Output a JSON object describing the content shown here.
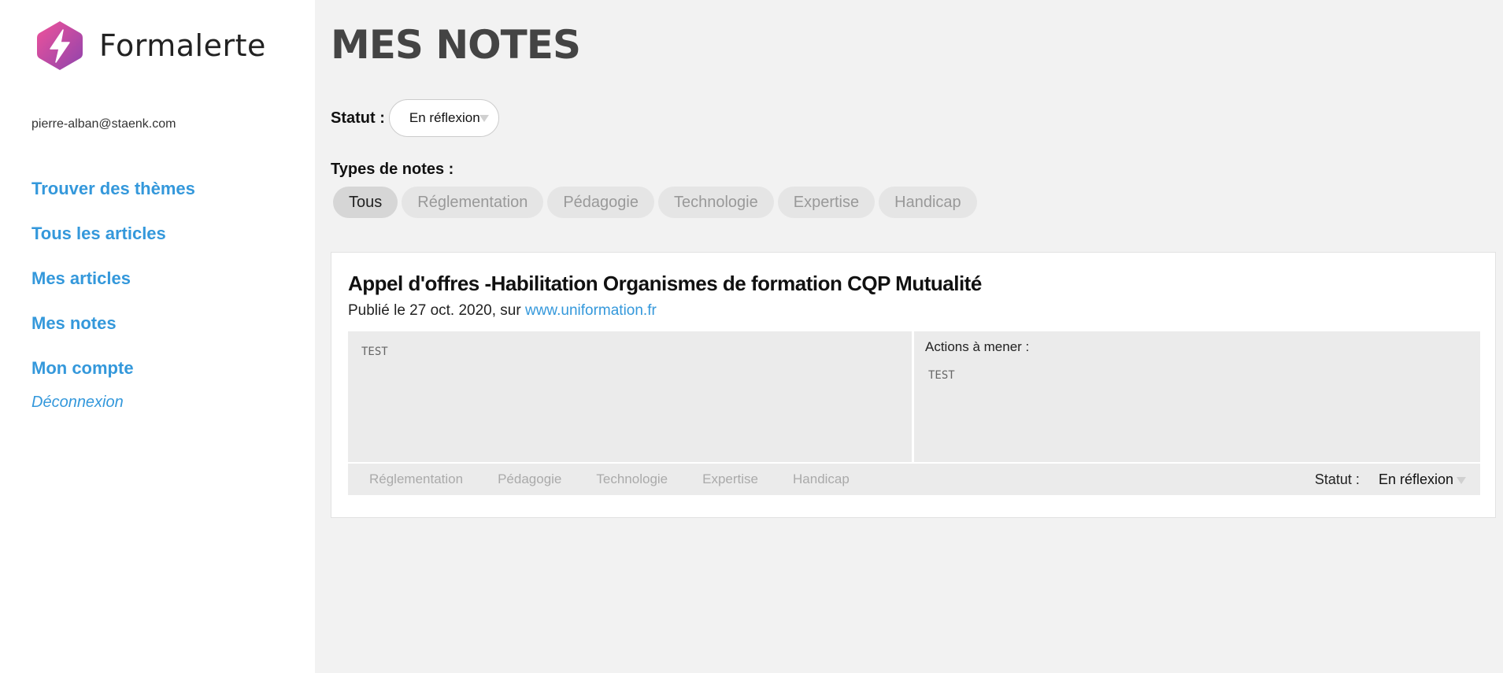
{
  "sidebar": {
    "brand_name": "Formalerte",
    "user_email": "pierre-alban@staenk.com",
    "nav_items": [
      {
        "label": "Trouver des thèmes"
      },
      {
        "label": "Tous les articles"
      },
      {
        "label": "Mes articles"
      },
      {
        "label": "Mes notes"
      },
      {
        "label": "Mon compte"
      }
    ],
    "logout_label": "Déconnexion"
  },
  "main": {
    "title": "MES NOTES",
    "status_label": "Statut :",
    "status_value": "En réflexion",
    "types_label": "Types de notes :",
    "type_filters": [
      {
        "label": "Tous",
        "active": true
      },
      {
        "label": "Réglementation"
      },
      {
        "label": "Pédagogie"
      },
      {
        "label": "Technologie"
      },
      {
        "label": "Expertise"
      },
      {
        "label": "Handicap"
      }
    ]
  },
  "note": {
    "title": "Appel d'offres -Habilitation Organismes de formation CQP Mutualité",
    "published_prefix": "Publié le 27 oct. 2020, sur ",
    "source_link": "www.uniformation.fr",
    "note_text": "TEST",
    "actions_label": "Actions à mener :",
    "actions_text": "TEST",
    "tags": [
      "Réglementation",
      "Pédagogie",
      "Technologie",
      "Expertise",
      "Handicap"
    ],
    "status_label": "Statut :",
    "status_value": "En réflexion"
  },
  "colors": {
    "accent": "#3498db",
    "logo_gradient_start": "#e84393",
    "logo_gradient_end": "#8e44ad"
  }
}
